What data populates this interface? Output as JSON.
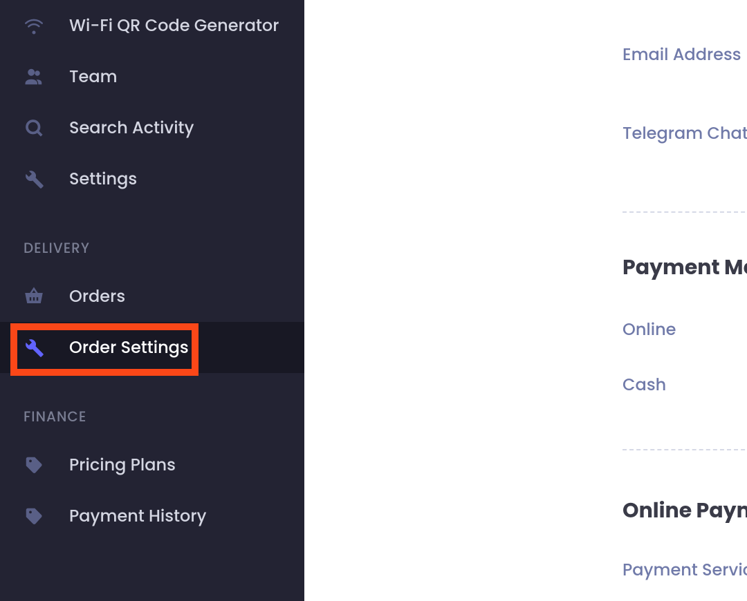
{
  "sidebar": {
    "items": {
      "wifi": {
        "label": "Wi-Fi QR Code Generator"
      },
      "team": {
        "label": "Team"
      },
      "search_activity": {
        "label": "Search Activity"
      },
      "settings": {
        "label": "Settings"
      },
      "orders": {
        "label": "Orders"
      },
      "order_settings": {
        "label": "Order Settings"
      },
      "pricing_plans": {
        "label": "Pricing Plans"
      },
      "payment_history": {
        "label": "Payment History"
      }
    },
    "sections": {
      "delivery": "DELIVERY",
      "finance": "FINANCE"
    }
  },
  "main": {
    "email_label": "Email Address",
    "telegram_label": "Telegram Chat Id",
    "payment_methods_heading": "Payment Methods",
    "payment_methods": {
      "online": "Online",
      "cash": "Cash"
    },
    "online_payment_heading": "Online Payment",
    "payment_service_label": "Payment Service"
  },
  "colors": {
    "accent": "#fb4718",
    "sidebar_bg": "#232333",
    "active_bg": "#181824",
    "active_icon": "#6163FF"
  }
}
